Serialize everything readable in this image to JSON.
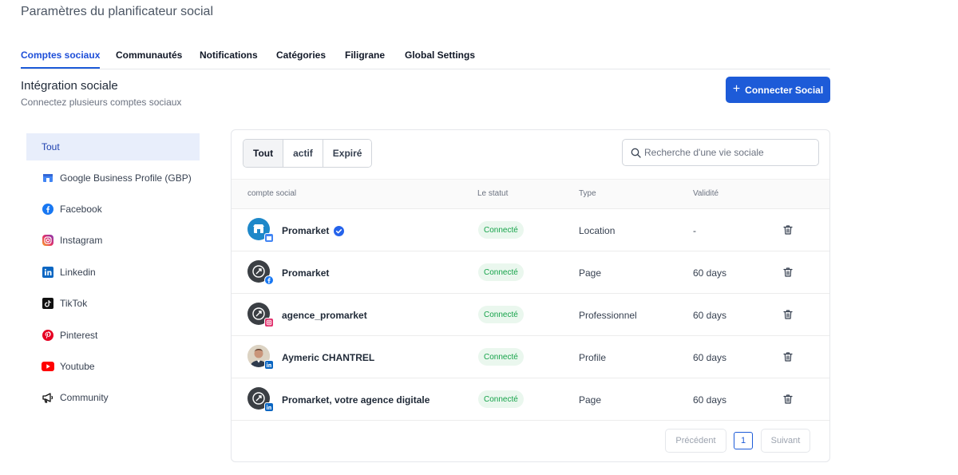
{
  "page_title": "Paramètres du planificateur social",
  "tabs": [
    {
      "label": "Comptes sociaux",
      "active": true
    },
    {
      "label": "Communautés"
    },
    {
      "label": "Notifications"
    },
    {
      "label": "Catégories"
    },
    {
      "label": "Filigrane"
    },
    {
      "label": "Global Settings"
    }
  ],
  "section": {
    "title": "Intégration sociale",
    "subtitle": "Connectez plusieurs comptes sociaux",
    "connect_label": "Connecter Social"
  },
  "sidebar": {
    "items": [
      {
        "label": "Tout",
        "icon": "none",
        "active": true
      },
      {
        "label": "Google Business Profile (GBP)",
        "icon": "google-business-icon"
      },
      {
        "label": "Facebook",
        "icon": "facebook-icon"
      },
      {
        "label": "Instagram",
        "icon": "instagram-icon"
      },
      {
        "label": "Linkedin",
        "icon": "linkedin-icon"
      },
      {
        "label": "TikTok",
        "icon": "tiktok-icon"
      },
      {
        "label": "Pinterest",
        "icon": "pinterest-icon"
      },
      {
        "label": "Youtube",
        "icon": "youtube-icon"
      },
      {
        "label": "Community",
        "icon": "megaphone-icon"
      }
    ]
  },
  "filters": [
    {
      "label": "Tout",
      "active": true
    },
    {
      "label": "actif"
    },
    {
      "label": "Expiré"
    }
  ],
  "search": {
    "placeholder": "Recherche d'une vie sociale"
  },
  "table": {
    "columns": [
      "compte social",
      "Le statut",
      "Type",
      "Validité"
    ],
    "rows": [
      {
        "name": "Promarket",
        "verified": true,
        "network": "google-business",
        "status": "Connecté",
        "type": "Location",
        "validity": "-"
      },
      {
        "name": "Promarket",
        "network": "facebook",
        "status": "Connecté",
        "type": "Page",
        "validity": "60 days"
      },
      {
        "name": "agence_promarket",
        "network": "instagram",
        "status": "Connecté",
        "type": "Professionnel",
        "validity": "60 days"
      },
      {
        "name": "Aymeric CHANTREL",
        "network": "linkedin",
        "status": "Connecté",
        "type": "Profile",
        "validity": "60 days"
      },
      {
        "name": "Promarket, votre agence digitale",
        "network": "linkedin",
        "status": "Connecté",
        "type": "Page",
        "validity": "60 days"
      }
    ]
  },
  "pagination": {
    "prev": "Précédent",
    "current": "1",
    "next": "Suivant"
  },
  "colors": {
    "accent": "#1d5bd8",
    "status_bg": "#eaf7ee",
    "status_text": "#16a34a"
  }
}
